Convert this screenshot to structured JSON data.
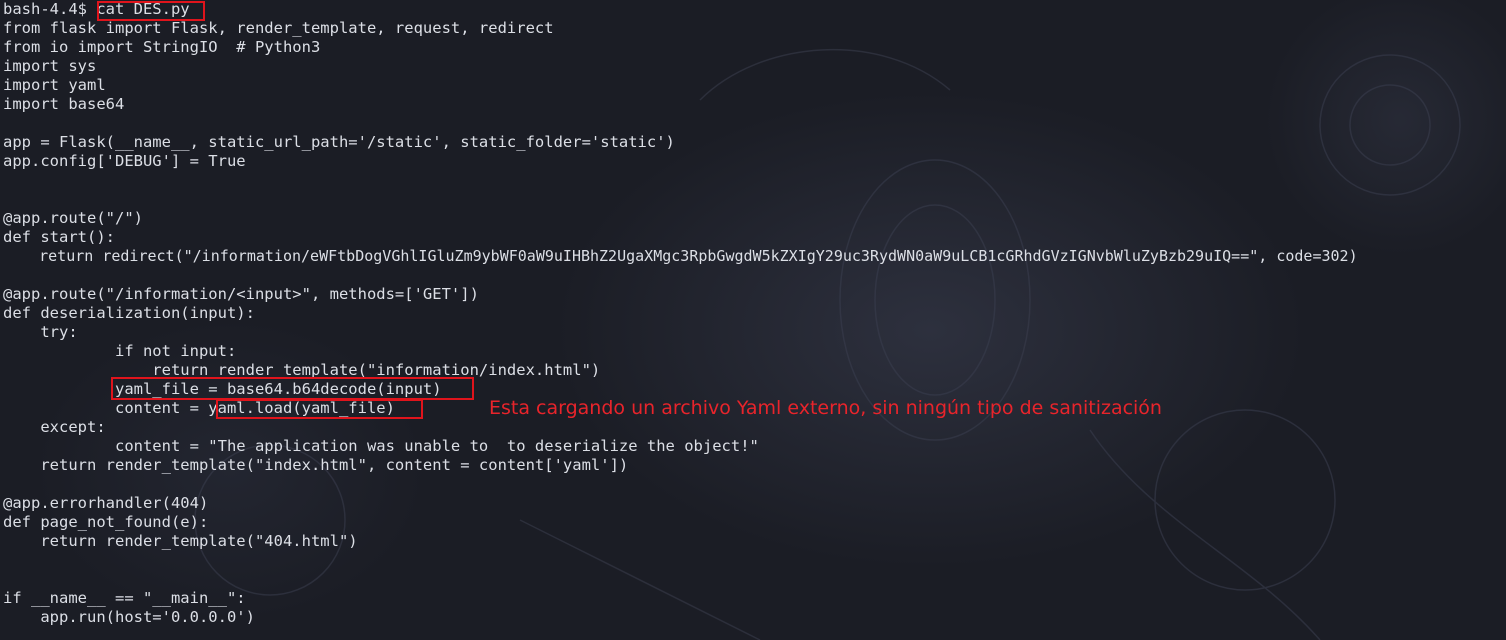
{
  "terminal": {
    "lines": [
      "bash-4.4$ cat DES.py",
      "from flask import Flask, render_template, request, redirect",
      "from io import StringIO  # Python3",
      "import sys",
      "import yaml",
      "import base64",
      "",
      "app = Flask(__name__, static_url_path='/static', static_folder='static')",
      "app.config['DEBUG'] = True",
      "",
      "",
      "@app.route(\"/\")",
      "def start():",
      "    return redirect(\"/information/eWFtbDogVGhlIGluZm9ybWF0aW9uIHBhZ2UgaXMgc3RpbGwgdW5kZXIgY29uc3RydWN0aW9uLCB1cGRhdGVzIGNvbWluZyBzb29uIQ==\", code=302)",
      "",
      "@app.route(\"/information/<input>\", methods=['GET'])",
      "def deserialization(input):",
      "    try:",
      "            if not input:",
      "                return render_template(\"information/index.html\")",
      "            yaml_file = base64.b64decode(input)",
      "            content = yaml.load(yaml_file)",
      "    except:",
      "            content = \"The application was unable to  to deserialize the object!\"",
      "    return render_template(\"index.html\", content = content['yaml'])",
      "",
      "@app.errorhandler(404)",
      "def page_not_found(e):",
      "    return render_template(\"404.html\")",
      "",
      "",
      "if __name__ == \"__main__\":",
      "    app.run(host='0.0.0.0')"
    ],
    "highlights": [
      "cat DES.py",
      "yaml_file = base64.b64decode(input)",
      "yaml.load(yaml_file)"
    ],
    "annotation": "Esta cargando un archivo Yaml externo, sin ningún tipo de sanitización"
  },
  "colors": {
    "background": "#1b1d25",
    "text": "#dcdfe6",
    "highlight_box": "#e0141c",
    "annotation": "#e8242b"
  }
}
